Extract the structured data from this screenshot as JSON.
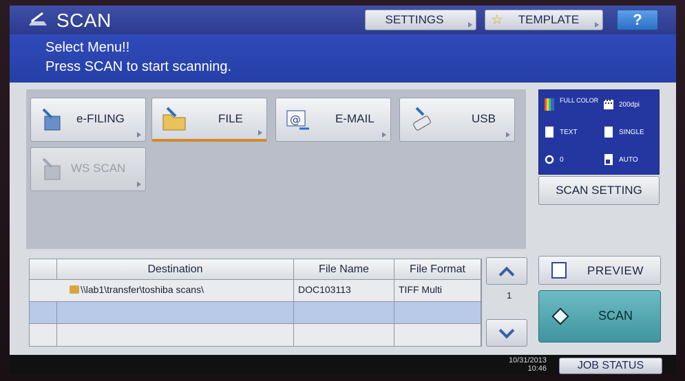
{
  "header": {
    "title": "SCAN",
    "settings_label": "SETTINGS",
    "template_label": "TEMPLATE",
    "help_label": "?"
  },
  "message": {
    "line1": "Select Menu!!",
    "line2": "Press SCAN to start scanning."
  },
  "destinations": [
    {
      "label": "e-FILING",
      "icon": "efiling-icon",
      "enabled": true,
      "selected": false
    },
    {
      "label": "FILE",
      "icon": "folder-icon",
      "enabled": true,
      "selected": true
    },
    {
      "label": "E-MAIL",
      "icon": "email-icon",
      "enabled": true,
      "selected": false
    },
    {
      "label": "USB",
      "icon": "usb-icon",
      "enabled": true,
      "selected": false
    },
    {
      "label": "WS SCAN",
      "icon": "wsscan-icon",
      "enabled": false,
      "selected": false
    }
  ],
  "scan_status": {
    "color_mode": "FULL COLOR",
    "resolution": "200dpi",
    "original_mode": "TEXT",
    "sides": "SINGLE",
    "rotation": "0",
    "size": "AUTO"
  },
  "scan_setting_label": "SCAN SETTING",
  "table": {
    "columns": [
      "Destination",
      "File Name",
      "File Format"
    ],
    "rows": [
      {
        "destination": "\\\\lab1\\transfer\\toshiba scans\\",
        "file_name": "DOC103113",
        "file_format": "TIFF Multi"
      },
      {
        "destination": "",
        "file_name": "",
        "file_format": ""
      },
      {
        "destination": "",
        "file_name": "",
        "file_format": ""
      }
    ],
    "page_indicator": "1"
  },
  "preview_label": "PREVIEW",
  "scan_label": "SCAN",
  "footer": {
    "date": "10/31/2013",
    "time": "10:46",
    "job_status_label": "JOB STATUS"
  },
  "colors": {
    "title_bar": "#2c3b8e",
    "message_bar": "#2640a8",
    "scan_button": "#4fa3ac",
    "status_box": "#2437a0"
  }
}
